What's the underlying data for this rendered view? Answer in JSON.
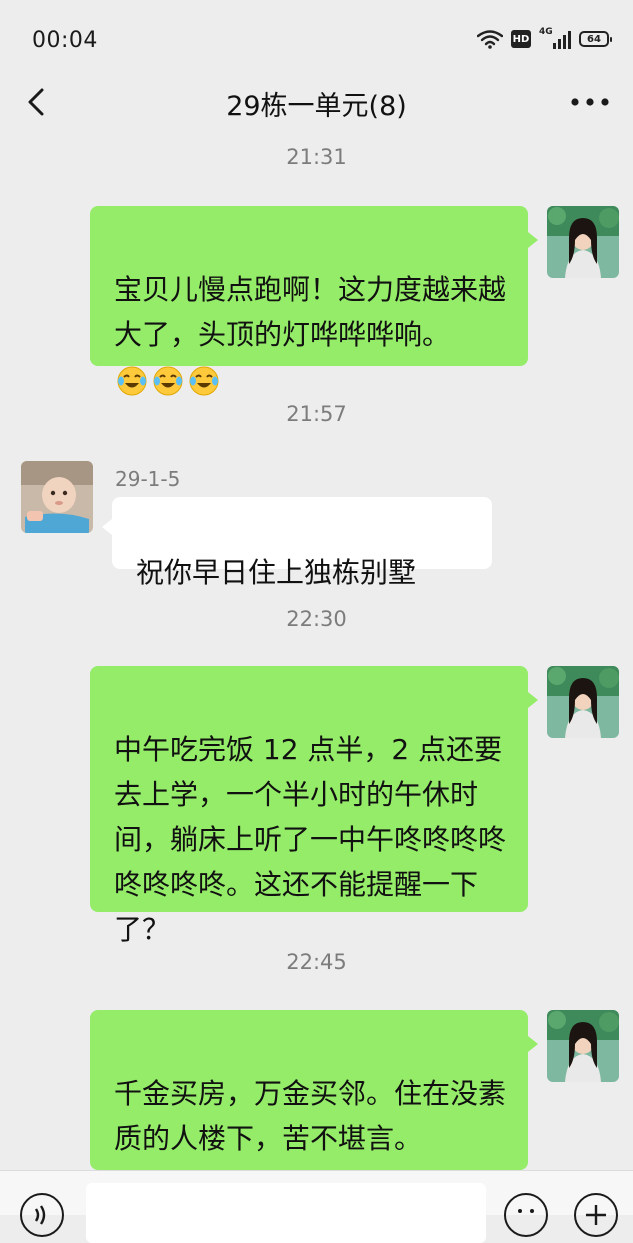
{
  "status_bar": {
    "time": "00:04",
    "hd_label": "HD",
    "network_label": "4G",
    "battery_level": "64",
    "icons": [
      "wifi-icon",
      "hd-icon",
      "signal-icon",
      "battery-icon"
    ]
  },
  "header": {
    "title": "29栋一单元(8)",
    "back_icon": "chevron-left-icon",
    "more_icon": "more-horizontal-icon"
  },
  "messages": [
    {
      "time": "21:31",
      "from": "me",
      "text": "宝贝儿慢点跑啊！这力度越来越大了，头顶的灯哗哗哗响。",
      "emoji_count": 3,
      "emoji": "face-with-tears-of-joy-icon"
    },
    {
      "time": "21:57",
      "from": "other",
      "sender": "29-1-5",
      "text": "祝你早日住上独栋别墅"
    },
    {
      "time": "22:30",
      "from": "me",
      "text": "中午吃完饭 12 点半，2 点还要去上学，一个半小时的午休时间，躺床上听了一中午咚咚咚咚咚咚咚咚。这还不能提醒一下了？"
    },
    {
      "time": "22:45",
      "from": "me",
      "text": "千金买房，万金买邻。住在没素质的人楼下，苦不堪言。"
    }
  ],
  "input_bar": {
    "placeholder": "",
    "left_icon": "voice-icon",
    "right_icons": [
      "emoji-icon",
      "plus-icon"
    ]
  },
  "colors": {
    "background": "#ededed",
    "my_bubble": "#95ec69",
    "other_bubble": "#ffffff",
    "timestamp_text": "#7c7c7c"
  }
}
